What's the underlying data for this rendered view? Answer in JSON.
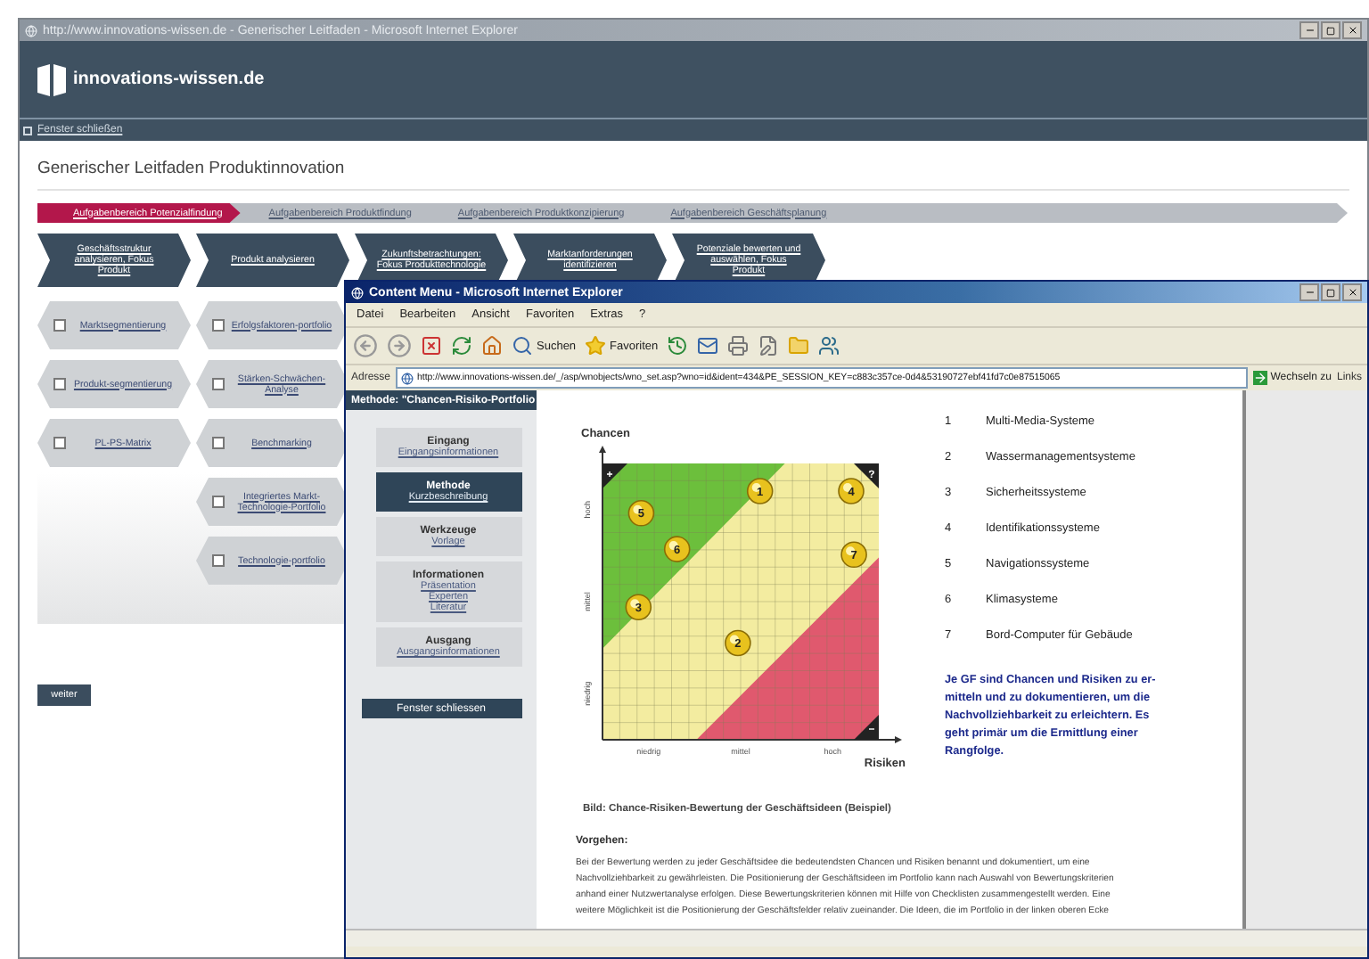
{
  "browser_window": {
    "title": "http://www.innovations-wissen.de - Generischer Leitfaden - Microsoft Internet Explorer"
  },
  "site": {
    "logo_text": "innovations-wissen.de",
    "close_link": "Fenster schließen",
    "page_title": "Generischer Leitfaden Produktinnovation"
  },
  "phases": [
    {
      "label": "Aufgabenbereich Potenzialfindung",
      "selected": true
    },
    {
      "label": "Aufgabenbereich Produktfindung",
      "selected": false
    },
    {
      "label": "Aufgabenbereich Produktkonzipierung",
      "selected": false
    },
    {
      "label": "Aufgabenbereich Geschäftsplanung",
      "selected": false
    }
  ],
  "steps": [
    "Geschäftsstruktur analysieren, Fokus Produkt",
    "Produkt analysieren",
    "Zukunftsbetrachtungen: Fokus Produkttechnologie",
    "Marktanforderungen identifizieren",
    "Potenziale bewerten und auswählen, Fokus Produkt"
  ],
  "task_columns": [
    [
      {
        "label": "Marktsegmentierung",
        "checked": false
      },
      {
        "label": "Produkt-segmentierung",
        "checked": false
      },
      {
        "label": "PL-PS-Matrix",
        "checked": false
      }
    ],
    [
      {
        "label": "Erfolgsfaktoren-portfolio",
        "checked": false
      },
      {
        "label": "Stärken-Schwächen-Analyse",
        "checked": false
      },
      {
        "label": "Benchmarking",
        "checked": false
      },
      {
        "label": "Integriertes Markt-Technologie-Portfolio",
        "checked": false
      },
      {
        "label": "Technologie-portfolio",
        "checked": false
      }
    ]
  ],
  "next_button": "weiter",
  "popup": {
    "title": "Content Menu - Microsoft Internet Explorer",
    "menu": [
      "Datei",
      "Bearbeiten",
      "Ansicht",
      "Favoriten",
      "Extras",
      "?"
    ],
    "search_label": "Suchen",
    "favorites_label": "Favoriten"
  },
  "address": {
    "label": "Adresse",
    "url": "http://www.innovations-wissen.de/_/asp/wnobjects/wno_set.asp?wno=id&ident=434&PE_SESSION_KEY=c883c357ce-0d4&53190727ebf41fd7c0e87515065",
    "go_label": "Wechseln zu",
    "links_label": "Links"
  },
  "method_panel": {
    "header": "Methode: \"Chancen-Risiko-Portfolio",
    "items": [
      {
        "title": "Eingang",
        "links": [
          "Eingangsinformationen"
        ],
        "selected": false
      },
      {
        "title": "Methode",
        "links": [
          "Kurzbeschreibung"
        ],
        "selected": true
      },
      {
        "title": "Werkzeuge",
        "links": [
          "Vorlage"
        ],
        "selected": false
      },
      {
        "title": "Informationen",
        "links": [
          "Präsentation",
          "Experten",
          "Literatur"
        ],
        "selected": false
      },
      {
        "title": "Ausgang",
        "links": [
          "Ausgangsinformationen"
        ],
        "selected": false
      }
    ],
    "close_button": "Fenster schliessen"
  },
  "content": {
    "chart": {
      "y_title": "Chancen",
      "x_title": "Risiken",
      "y_labels": [
        "hoch",
        "mittel",
        "niedrig"
      ],
      "x_labels": [
        "niedrig",
        "mittel",
        "hoch"
      ],
      "corner_marks": [
        "+",
        "?",
        "−"
      ],
      "markers": [
        "1",
        "4",
        "5",
        "6",
        "7",
        "3",
        "2"
      ]
    },
    "legend": [
      {
        "number": "1",
        "name": "Multi-Media-Systeme"
      },
      {
        "number": "2",
        "name": "Wassermanagementsysteme"
      },
      {
        "number": "3",
        "name": "Sicherheitssysteme"
      },
      {
        "number": "4",
        "name": "Identifikationssysteme"
      },
      {
        "number": "5",
        "name": "Navigationssysteme"
      },
      {
        "number": "6",
        "name": "Klimasysteme"
      },
      {
        "number": "7",
        "name": "Bord-Computer für Gebäude"
      }
    ],
    "note": "Je GF sind Chancen und Risiken zu er-\nmitteln und zu dokumentieren, um die\nNachvollziehbarkeit zu erleichtern. Es\ngeht primär um die Ermittlung einer\nRangfolge.",
    "caption": "Bild: Chance-Risiken-Bewertung der Geschäftsideen (Beispiel)",
    "section_title": "Vorgehen:",
    "paragraph": "Bei der Bewertung werden zu jeder Geschäftsidee die bedeutendsten Chancen und Risiken benannt und dokumentiert, um eine\nNachvollziehbarkeit zu gewährleisten. Die Positionierung der Geschäftsideen im Portfolio kann nach Auswahl von Bewertungskriterien\nanhand einer Nutzwertanalyse erfolgen. Diese Bewertungskriterien können mit Hilfe von Checklisten zusammengestellt werden. Eine\nweitere Möglichkeit ist die Positionierung der Geschäftsfelder relativ zueinander. Die Ideen, die im Portfolio in der linken oberen Ecke"
  }
}
